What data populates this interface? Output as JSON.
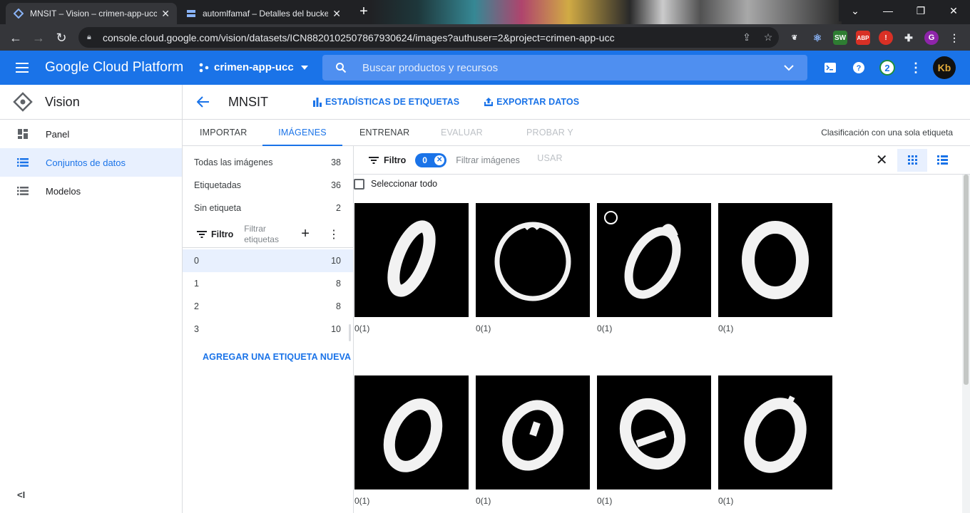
{
  "browser": {
    "tabs": [
      {
        "title": "MNSIT – Vision – crimen-app-ucc"
      },
      {
        "title": "automlfamaf – Detalles del bucket"
      }
    ],
    "url": "console.cloud.google.com/vision/datasets/ICN8820102507867930624/images?authuser=2&project=crimen-app-ucc"
  },
  "header": {
    "brand": "Google Cloud Platform",
    "project": "crimen-app-ucc",
    "search_placeholder": "Buscar productos y recursos",
    "notifications": "2"
  },
  "sidebar": {
    "title": "Vision",
    "items": [
      {
        "label": "Panel"
      },
      {
        "label": "Conjuntos de datos"
      },
      {
        "label": "Modelos"
      }
    ]
  },
  "toolbar": {
    "dataset": "MNSIT",
    "stats": "ESTADÍSTICAS DE ETIQUETAS",
    "export": "EXPORTAR DATOS"
  },
  "tabs": [
    {
      "label": "IMPORTAR"
    },
    {
      "label": "IMÁGENES"
    },
    {
      "label": "ENTRENAR"
    },
    {
      "label": "EVALUAR"
    },
    {
      "label": "PROBAR Y USAR"
    }
  ],
  "tab_info": "Clasificación con una sola etiqueta",
  "labels": {
    "summary": [
      {
        "name": "Todas las imágenes",
        "count": "38"
      },
      {
        "name": "Etiquetadas",
        "count": "36"
      },
      {
        "name": "Sin etiqueta",
        "count": "2"
      }
    ],
    "filter_label": "Filtro",
    "filter_placeholder": "Filtrar etiquetas",
    "items": [
      {
        "name": "0",
        "count": "10"
      },
      {
        "name": "1",
        "count": "8"
      },
      {
        "name": "2",
        "count": "8"
      },
      {
        "name": "3",
        "count": "10"
      }
    ],
    "add": "AGREGAR UNA ETIQUETA NUEVA"
  },
  "grid": {
    "filter_label": "Filtro",
    "chip": "0",
    "filter_placeholder": "Filtrar imágenes",
    "select_all": "Seleccionar todo",
    "images": [
      {
        "caption": "0(1)"
      },
      {
        "caption": "0(1)"
      },
      {
        "caption": "0(1)"
      },
      {
        "caption": "0(1)"
      },
      {
        "caption": "0(1)"
      },
      {
        "caption": "0(1)"
      },
      {
        "caption": "0(1)"
      },
      {
        "caption": "0(1)"
      }
    ]
  },
  "colors": {
    "gcp_blue": "#1a73e8",
    "selected_bg": "#e8f0fe"
  }
}
